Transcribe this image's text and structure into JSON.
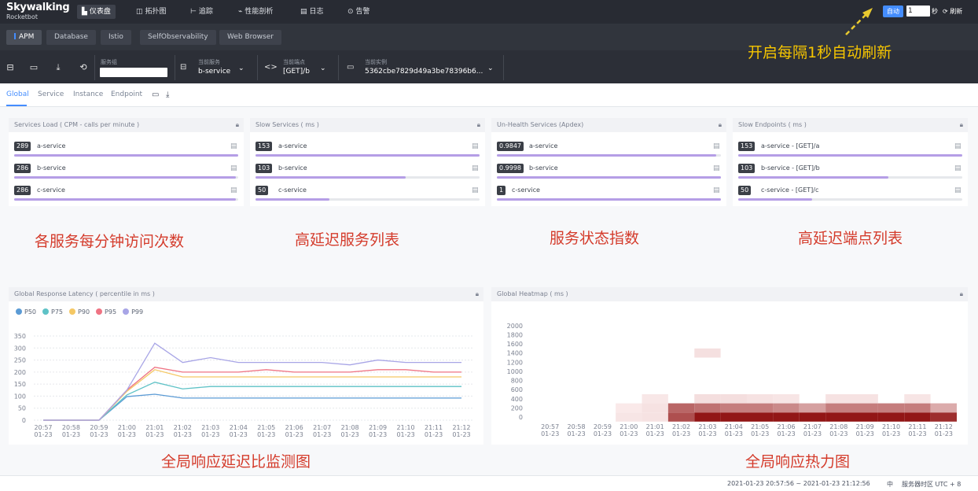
{
  "app": {
    "logo_title": "Skywalking",
    "logo_subtitle": "Rocketbot"
  },
  "nav": [
    {
      "icon": "dashboard-icon",
      "glyph": "▙",
      "label": "仪表盘",
      "active": true
    },
    {
      "icon": "topology-icon",
      "glyph": "◫",
      "label": "拓扑图",
      "active": false
    },
    {
      "icon": "trace-icon",
      "glyph": "⊢",
      "label": "追踪",
      "active": false
    },
    {
      "icon": "profile-icon",
      "glyph": "⌁",
      "label": "性能剖析",
      "active": false
    },
    {
      "icon": "log-icon",
      "glyph": "▤",
      "label": "日志",
      "active": false
    },
    {
      "icon": "alarm-icon",
      "glyph": "⊙",
      "label": "告警",
      "active": false
    }
  ],
  "auto_refresh": {
    "button_label": "自动",
    "interval_value": "1",
    "unit": "秒",
    "refresh_label": "刷新",
    "accent": "#448dfe"
  },
  "layers": [
    "APM",
    "Database",
    "Istio",
    "SelfObservability",
    "Web Browser"
  ],
  "selectors": {
    "service_group": {
      "label": "服务组",
      "value": ""
    },
    "service": {
      "label": "当前服务",
      "value": "b-service"
    },
    "endpoint": {
      "label": "当前端点",
      "value": "[GET]/b"
    },
    "instance": {
      "label": "当前实例",
      "value": "5362cbe7829d49a3be78396b6..."
    }
  },
  "tabs": [
    "Global",
    "Service",
    "Instance",
    "Endpoint"
  ],
  "cards": [
    {
      "title": "Services Load ( CPM - calls per minute )",
      "rows": [
        {
          "value": "289",
          "name": "a-service",
          "fraction": 1.0
        },
        {
          "value": "286",
          "name": "b-service",
          "fraction": 0.99
        },
        {
          "value": "286",
          "name": "c-service",
          "fraction": 0.99
        }
      ]
    },
    {
      "title": "Slow Services ( ms )",
      "rows": [
        {
          "value": "153",
          "name": "a-service",
          "fraction": 1.0
        },
        {
          "value": "103",
          "name": "b-service",
          "fraction": 0.67
        },
        {
          "value": "50",
          "name": "c-service",
          "fraction": 0.33
        }
      ]
    },
    {
      "title": "Un-Health Services (Apdex)",
      "rows": [
        {
          "value": "0.9847",
          "name": "a-service",
          "fraction": 0.98
        },
        {
          "value": "0.9998",
          "name": "b-service",
          "fraction": 1.0
        },
        {
          "value": "1",
          "name": "c-service",
          "fraction": 1.0
        }
      ]
    },
    {
      "title": "Slow Endpoints ( ms )",
      "rows": [
        {
          "value": "153",
          "name": "a-service - [GET]/a",
          "fraction": 1.0
        },
        {
          "value": "103",
          "name": "b-service - [GET]/b",
          "fraction": 0.67
        },
        {
          "value": "50",
          "name": "c-service - [GET]/c",
          "fraction": 0.33
        }
      ]
    }
  ],
  "annotations": {
    "top_right": "开启每隔1秒自动刷新",
    "load": "各服务每分钟访问次数",
    "slow_services": "高延迟服务列表",
    "health": "服务状态指数",
    "slow_endpoints": "高延迟端点列表",
    "latency": "全局响应延迟比监测图",
    "heatmap": "全局响应热力图"
  },
  "latency_chart": {
    "title": "Global Response Latency ( percentile in ms )",
    "chart_data": {
      "type": "line",
      "categories": [
        "20:57\n01-23",
        "20:58\n01-23",
        "20:59\n01-23",
        "21:00\n01-23",
        "21:01\n01-23",
        "21:02\n01-23",
        "21:03\n01-23",
        "21:04\n01-23",
        "21:05\n01-23",
        "21:06\n01-23",
        "21:07\n01-23",
        "21:08\n01-23",
        "21:09\n01-23",
        "21:10\n01-23",
        "21:11\n01-23",
        "21:12\n01-23"
      ],
      "ylim": [
        0,
        350
      ],
      "yticks": [
        0,
        50,
        100,
        150,
        200,
        250,
        300,
        350
      ],
      "series": [
        {
          "name": "P50",
          "color": "#5b9bd5",
          "values": [
            0,
            0,
            0,
            98,
            108,
            92,
            92,
            92,
            92,
            92,
            92,
            92,
            92,
            92,
            92,
            92
          ]
        },
        {
          "name": "P75",
          "color": "#5ec2c6",
          "values": [
            0,
            0,
            0,
            105,
            158,
            130,
            140,
            140,
            140,
            140,
            140,
            140,
            140,
            140,
            140,
            140
          ]
        },
        {
          "name": "P90",
          "color": "#f5c864",
          "values": [
            0,
            0,
            0,
            120,
            210,
            180,
            180,
            180,
            180,
            180,
            180,
            180,
            180,
            180,
            180,
            180
          ]
        },
        {
          "name": "P95",
          "color": "#ef7383",
          "values": [
            0,
            0,
            0,
            125,
            220,
            200,
            200,
            200,
            210,
            200,
            200,
            200,
            210,
            210,
            200,
            200
          ]
        },
        {
          "name": "P99",
          "color": "#a8a5e6",
          "values": [
            0,
            0,
            0,
            125,
            320,
            240,
            260,
            240,
            240,
            240,
            240,
            230,
            250,
            240,
            240,
            240
          ]
        }
      ]
    }
  },
  "heatmap_chart": {
    "title": "Global Heatmap ( ms )",
    "chart_data": {
      "type": "heatmap",
      "categories": [
        "20:57\n01-23",
        "20:58\n01-23",
        "20:59\n01-23",
        "21:00\n01-23",
        "21:01\n01-23",
        "21:02\n01-23",
        "21:03\n01-23",
        "21:04\n01-23",
        "21:05\n01-23",
        "21:06\n01-23",
        "21:07\n01-23",
        "21:08\n01-23",
        "21:09\n01-23",
        "21:10\n01-23",
        "21:11\n01-23",
        "21:12\n01-23"
      ],
      "y": [
        0,
        200,
        400,
        600,
        800,
        1000,
        1200,
        1400,
        1600,
        1800,
        2000
      ],
      "cells": [
        {
          "x": 3,
          "y": 0,
          "v": 0.05
        },
        {
          "x": 3,
          "y": 1,
          "v": 0.03
        },
        {
          "x": 4,
          "y": 0,
          "v": 0.06
        },
        {
          "x": 4,
          "y": 1,
          "v": 0.06
        },
        {
          "x": 4,
          "y": 2,
          "v": 0.04
        },
        {
          "x": 5,
          "y": 0,
          "v": 0.7
        },
        {
          "x": 5,
          "y": 1,
          "v": 0.6
        },
        {
          "x": 6,
          "y": 0,
          "v": 0.95
        },
        {
          "x": 6,
          "y": 1,
          "v": 0.55
        },
        {
          "x": 6,
          "y": 2,
          "v": 0.08
        },
        {
          "x": 6,
          "y": 7,
          "v": 0.07
        },
        {
          "x": 7,
          "y": 0,
          "v": 0.95
        },
        {
          "x": 7,
          "y": 1,
          "v": 0.5
        },
        {
          "x": 7,
          "y": 2,
          "v": 0.08
        },
        {
          "x": 8,
          "y": 0,
          "v": 0.95
        },
        {
          "x": 8,
          "y": 1,
          "v": 0.5
        },
        {
          "x": 8,
          "y": 2,
          "v": 0.06
        },
        {
          "x": 9,
          "y": 0,
          "v": 0.95
        },
        {
          "x": 9,
          "y": 1,
          "v": 0.45
        },
        {
          "x": 9,
          "y": 2,
          "v": 0.05
        },
        {
          "x": 10,
          "y": 0,
          "v": 0.95
        },
        {
          "x": 10,
          "y": 1,
          "v": 0.35
        },
        {
          "x": 11,
          "y": 0,
          "v": 0.95
        },
        {
          "x": 11,
          "y": 1,
          "v": 0.5
        },
        {
          "x": 11,
          "y": 2,
          "v": 0.06
        },
        {
          "x": 12,
          "y": 0,
          "v": 0.95
        },
        {
          "x": 12,
          "y": 1,
          "v": 0.5
        },
        {
          "x": 12,
          "y": 2,
          "v": 0.06
        },
        {
          "x": 13,
          "y": 0,
          "v": 0.95
        },
        {
          "x": 13,
          "y": 1,
          "v": 0.5
        },
        {
          "x": 14,
          "y": 0,
          "v": 0.95
        },
        {
          "x": 14,
          "y": 1,
          "v": 0.5
        },
        {
          "x": 14,
          "y": 2,
          "v": 0.05
        },
        {
          "x": 15,
          "y": 0,
          "v": 0.85
        },
        {
          "x": 15,
          "y": 1,
          "v": 0.3
        }
      ]
    }
  },
  "footer": {
    "range": "2021-01-23 20:57:56 ~ 2021-01-23 21:12:56",
    "lang": "中",
    "timezone": "服务器时区 UTC + 8"
  }
}
